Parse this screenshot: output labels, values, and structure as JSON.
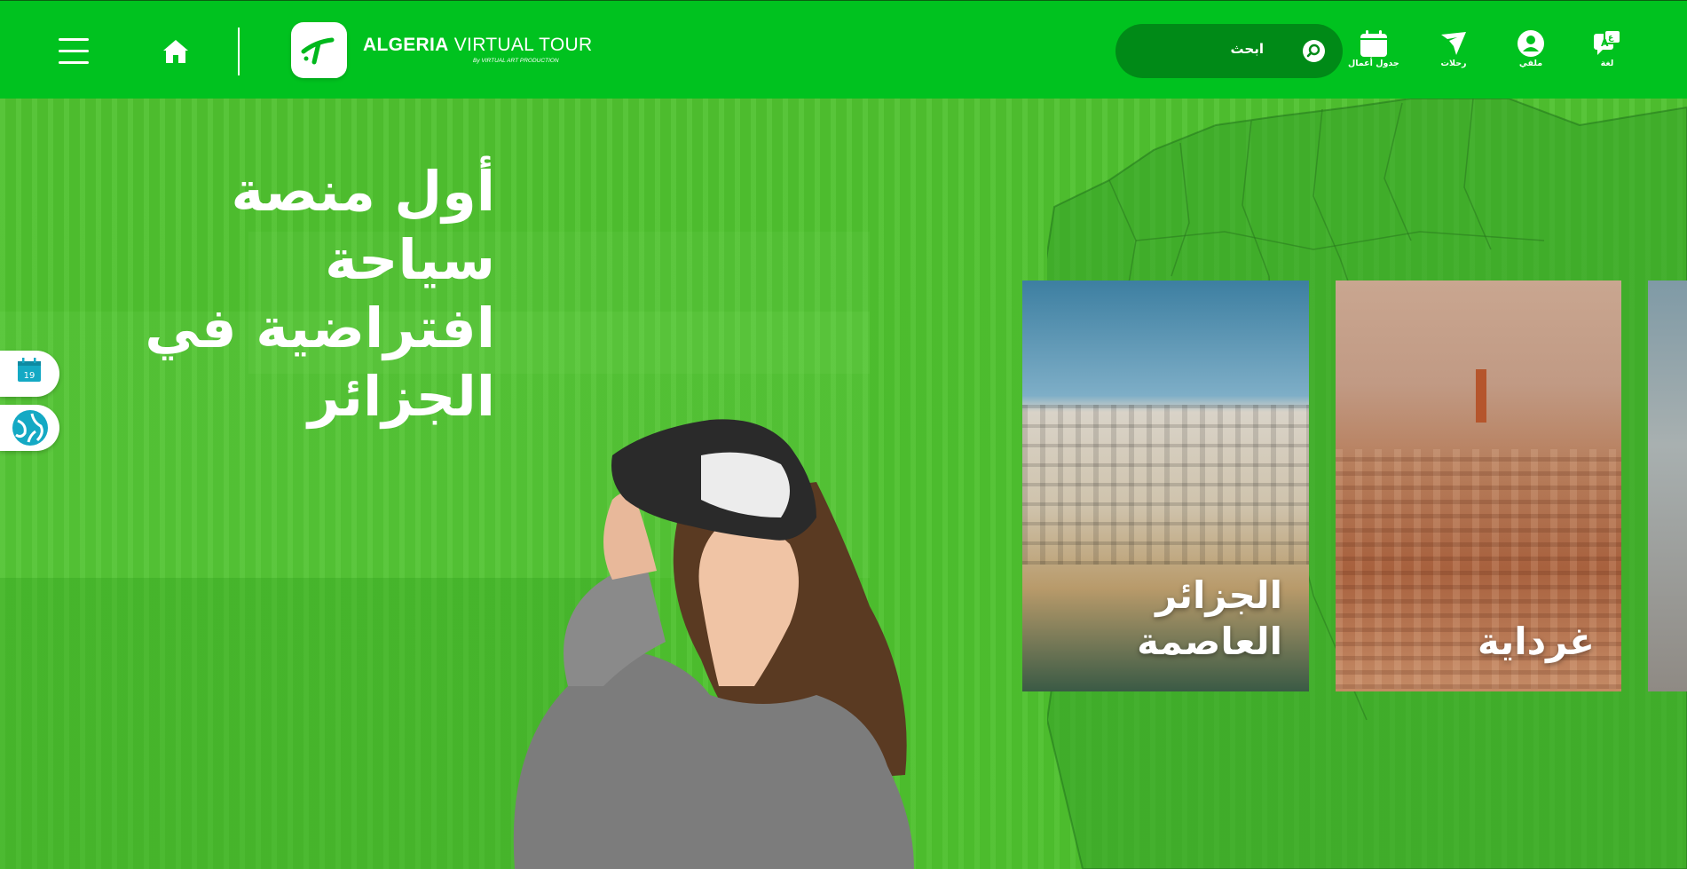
{
  "header": {
    "brand_bold": "ALGERIA",
    "brand_rest": "VIRTUAL TOUR",
    "brand_sub": "By VIRTUAL ART PRODUCTION",
    "search_label": "ابحث",
    "nav": [
      {
        "label": "لغة",
        "icon": "language-icon"
      },
      {
        "label": "ملفي",
        "icon": "user-icon"
      },
      {
        "label": "رحلات",
        "icon": "plane-icon"
      },
      {
        "label": "جدول أعمال",
        "icon": "calendar-icon"
      }
    ]
  },
  "hero": {
    "title_lines": [
      "أول منصة",
      "سياحة",
      "افتراضية في",
      "الجزائر"
    ]
  },
  "side": {
    "calendar_day": "19"
  },
  "cards": [
    {
      "label_lines": [
        "الجزائر",
        "العاصمة"
      ]
    },
    {
      "label_lines": [
        "غرداية"
      ]
    }
  ],
  "colors": {
    "header_bg": "#00c21f",
    "search_bg": "#008a17",
    "hero_overlay": "#4fc22f",
    "accent_teal": "#14a9c4"
  }
}
